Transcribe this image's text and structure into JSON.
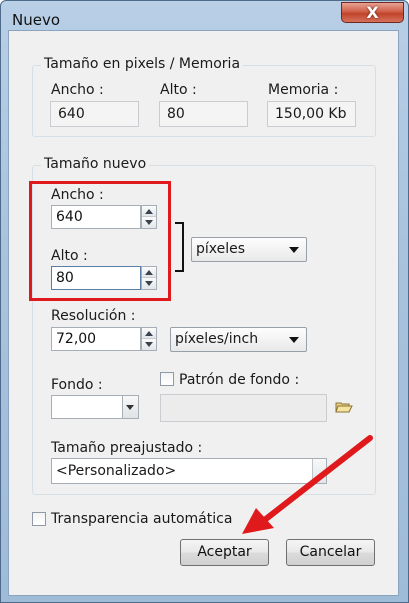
{
  "window": {
    "title": "Nuevo",
    "close_symbol": "X"
  },
  "size_memory": {
    "group_title": "Tamaño en pixels / Memoria",
    "width_label": "Ancho :",
    "width_value": "640",
    "height_label": "Alto :",
    "height_value": "80",
    "memory_label": "Memoria :",
    "memory_value": "150,00 Kb"
  },
  "new_size": {
    "group_title": "Tamaño nuevo",
    "width_label": "Ancho :",
    "width_value": "640",
    "height_label": "Alto :",
    "height_value": "80",
    "unit_select": "píxeles",
    "resolution_label": "Resolución :",
    "resolution_value": "72,00",
    "resolution_unit": "píxeles/inch",
    "background_label": "Fondo :",
    "pattern_label": "Patrón de fondo :",
    "pattern_value": "",
    "preset_label": "Tamaño preajustado :",
    "preset_value": "<Personalizado>"
  },
  "auto_transparency_label": "Transparencia automática",
  "buttons": {
    "accept": "Aceptar",
    "cancel": "Cancelar"
  },
  "colors": {
    "annotation_red": "#e0191c",
    "close_red": "#c1432b"
  }
}
